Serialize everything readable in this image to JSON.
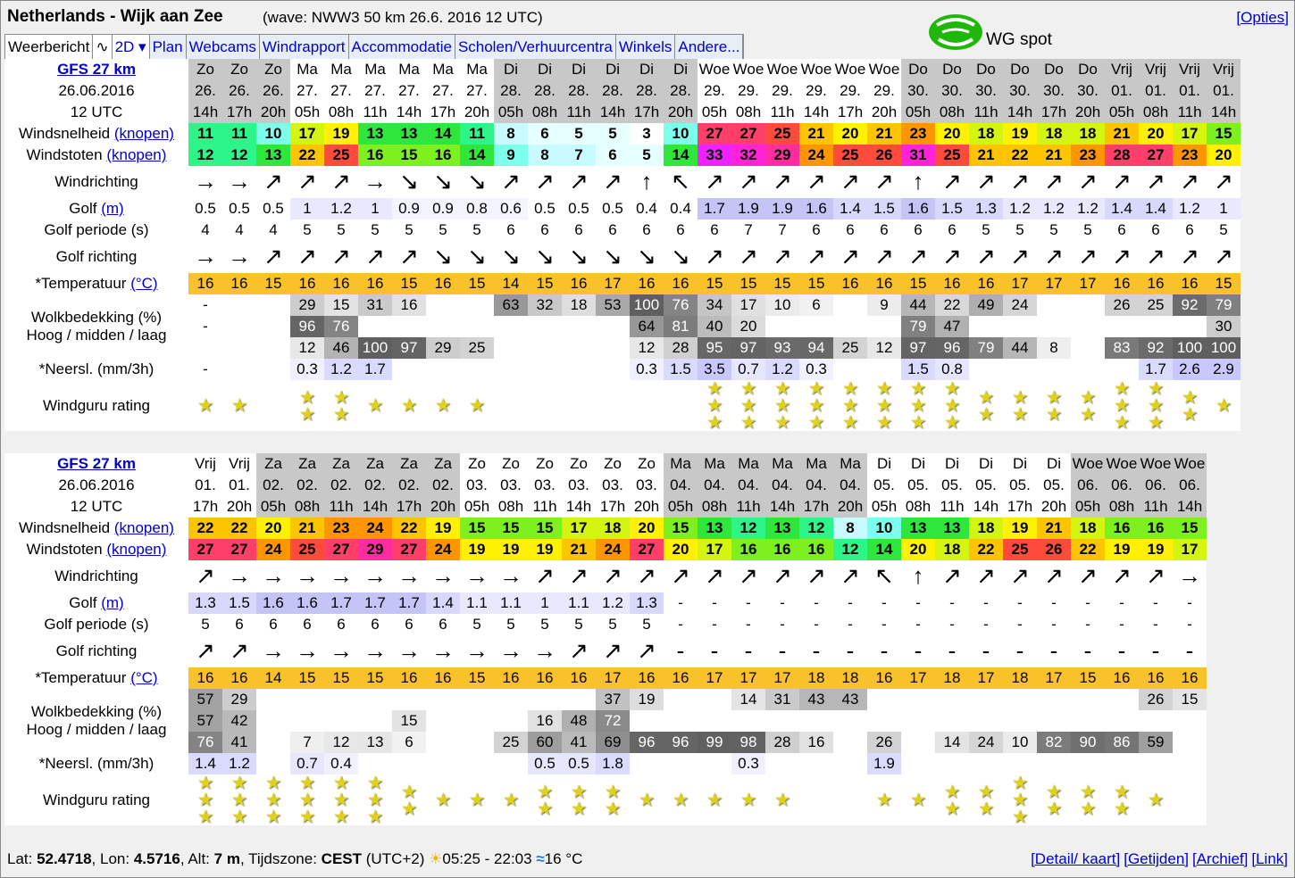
{
  "header": {
    "title": "Netherlands - Wijk aan Zee",
    "wave": "(wave: NWW3 50 km 26.6. 2016 12 UTC)",
    "opties": "[Opties]"
  },
  "tabs": [
    "Weerbericht",
    "∿",
    "2D ▾",
    "Plan",
    "Webcams",
    "Windrapport",
    "Accommodatie",
    "Scholen/Verhuurcentra",
    "Winkels",
    "Andere..."
  ],
  "logo": {
    "text": "WG spot",
    "color": "#1fb80a"
  },
  "labels": {
    "wind": "Windsnelheid",
    "gusts": "Windstoten",
    "knopen": "(knopen)",
    "dir": "Windrichting",
    "golf": "Golf",
    "m": "(m)",
    "periode": "Golf periode (s)",
    "golfrichting": "Golf richting",
    "temp": "*Temperatuur",
    "degc": "(°C)",
    "clouds1": "Wolkbedekking (%)",
    "clouds2": "Hoog / midden / laag",
    "rain": "*Neersl. (mm/3h)",
    "rating": "Windguru rating"
  },
  "colors": {
    "grey_day_bg": "#c8c8c8",
    "temp_bg": "#f9c22b",
    "link": "#0000cc"
  },
  "tables": [
    {
      "model": "GFS 27 km",
      "date": "26.06.2016",
      "utc": "12 UTC",
      "days": [
        "Zo",
        "Zo",
        "Zo",
        "Ma",
        "Ma",
        "Ma",
        "Ma",
        "Ma",
        "Ma",
        "Di",
        "Di",
        "Di",
        "Di",
        "Di",
        "Di",
        "Woe",
        "Woe",
        "Woe",
        "Woe",
        "Woe",
        "Woe",
        "Do",
        "Do",
        "Do",
        "Do",
        "Do",
        "Do",
        "Vrij",
        "Vrij",
        "Vrij",
        "Vrij"
      ],
      "dates": [
        "26.",
        "26.",
        "26.",
        "27.",
        "27.",
        "27.",
        "27.",
        "27.",
        "27.",
        "28.",
        "28.",
        "28.",
        "28.",
        "28.",
        "28.",
        "29.",
        "29.",
        "29.",
        "29.",
        "29.",
        "29.",
        "30.",
        "30.",
        "30.",
        "30.",
        "30.",
        "30.",
        "01.",
        "01.",
        "01.",
        "01."
      ],
      "hours": [
        "14h",
        "17h",
        "20h",
        "05h",
        "08h",
        "11h",
        "14h",
        "17h",
        "20h",
        "05h",
        "08h",
        "11h",
        "14h",
        "17h",
        "20h",
        "05h",
        "08h",
        "11h",
        "14h",
        "17h",
        "20h",
        "05h",
        "08h",
        "11h",
        "14h",
        "17h",
        "20h",
        "05h",
        "08h",
        "11h",
        "14h"
      ],
      "wind": [
        "11",
        "11",
        "10",
        "17",
        "19",
        "13",
        "13",
        "14",
        "11",
        "8",
        "6",
        "5",
        "5",
        "3",
        "10",
        "27",
        "27",
        "25",
        "21",
        "20",
        "21",
        "23",
        "20",
        "18",
        "19",
        "18",
        "18",
        "21",
        "20",
        "17",
        "15"
      ],
      "gust": [
        "12",
        "12",
        "13",
        "22",
        "25",
        "16",
        "15",
        "16",
        "14",
        "9",
        "8",
        "7",
        "6",
        "5",
        "14",
        "33",
        "32",
        "29",
        "24",
        "25",
        "26",
        "31",
        "25",
        "21",
        "22",
        "21",
        "23",
        "28",
        "27",
        "23",
        "20"
      ],
      "dir": [
        "→",
        "→",
        "↗",
        "↗",
        "↗",
        "→",
        "↘",
        "↘",
        "↘",
        "↗",
        "↗",
        "↗",
        "↗",
        "↑",
        "↖",
        "↗",
        "↗",
        "↗",
        "↗",
        "↗",
        "↗",
        "↑",
        "↗",
        "↗",
        "↗",
        "↗",
        "↗",
        "↗",
        "↗",
        "↗",
        "↗"
      ],
      "golf": [
        "0.5",
        "0.5",
        "0.5",
        "1",
        "1.2",
        "1",
        "0.9",
        "0.9",
        "0.8",
        "0.6",
        "0.5",
        "0.5",
        "0.5",
        "0.4",
        "0.4",
        "1.7",
        "1.9",
        "1.9",
        "1.6",
        "1.4",
        "1.5",
        "1.6",
        "1.5",
        "1.3",
        "1.2",
        "1.2",
        "1.2",
        "1.4",
        "1.4",
        "1.2",
        "1"
      ],
      "periode": [
        "4",
        "4",
        "4",
        "5",
        "5",
        "5",
        "5",
        "5",
        "5",
        "6",
        "6",
        "6",
        "6",
        "6",
        "6",
        "6",
        "7",
        "7",
        "6",
        "6",
        "6",
        "6",
        "6",
        "5",
        "5",
        "5",
        "5",
        "6",
        "6",
        "6",
        "5"
      ],
      "golfdir": [
        "→",
        "→",
        "↗",
        "↗",
        "↗",
        "↗",
        "↗",
        "↘",
        "↘",
        "↘",
        "↘",
        "↘",
        "↘",
        "↘",
        "↘",
        "↗",
        "↗",
        "↗",
        "↗",
        "↗",
        "↗",
        "↗",
        "↗",
        "↗",
        "↗",
        "↗",
        "↗",
        "↗",
        "↗",
        "↗",
        "↗"
      ],
      "temp": [
        "16",
        "16",
        "15",
        "16",
        "16",
        "16",
        "15",
        "16",
        "15",
        "14",
        "15",
        "16",
        "17",
        "16",
        "16",
        "15",
        "15",
        "15",
        "15",
        "16",
        "16",
        "15",
        "16",
        "16",
        "17",
        "17",
        "17",
        "16",
        "16",
        "16",
        "15"
      ],
      "cloud_hi": [
        "-",
        "",
        "",
        "29",
        "15",
        "31",
        "16",
        "",
        "",
        "63",
        "32",
        "18",
        "53",
        "100",
        "76",
        "34",
        "17",
        "10",
        "6",
        "",
        "9",
        "44",
        "22",
        "49",
        "24",
        "",
        "",
        "26",
        "25",
        "92",
        "79"
      ],
      "cloud_mid": [
        "-",
        "",
        "",
        "96",
        "76",
        "",
        "",
        "",
        "",
        "",
        "",
        "",
        "",
        "64",
        "81",
        "40",
        "20",
        "",
        "",
        "",
        "",
        "79",
        "47",
        "",
        "",
        "",
        "",
        "",
        "",
        "",
        "30"
      ],
      "cloud_lo": [
        "",
        "",
        "",
        "12",
        "46",
        "100",
        "97",
        "29",
        "25",
        "",
        "",
        "",
        "",
        "12",
        "28",
        "95",
        "97",
        "93",
        "94",
        "25",
        "12",
        "97",
        "96",
        "79",
        "44",
        "8",
        "",
        "83",
        "92",
        "100",
        "100"
      ],
      "rain": [
        "-",
        "",
        "",
        "0.3",
        "1.2",
        "1.7",
        "",
        "",
        "",
        "",
        "",
        "",
        "",
        "0.3",
        "1.5",
        "3.5",
        "0.7",
        "1.2",
        "0.3",
        "",
        "",
        "1.5",
        "0.8",
        "",
        "",
        "",
        "",
        "",
        "1.7",
        "2.6",
        "2.9"
      ],
      "stars": [
        1,
        1,
        0,
        2,
        2,
        1,
        1,
        1,
        1,
        0,
        0,
        0,
        0,
        0,
        0,
        3,
        3,
        3,
        3,
        3,
        3,
        3,
        3,
        2,
        2,
        2,
        2,
        3,
        3,
        2,
        1
      ]
    },
    {
      "model": "GFS 27 km",
      "date": "26.06.2016",
      "utc": "12 UTC",
      "days": [
        "Vrij",
        "Vrij",
        "Za",
        "Za",
        "Za",
        "Za",
        "Za",
        "Za",
        "Zo",
        "Zo",
        "Zo",
        "Zo",
        "Zo",
        "Zo",
        "Ma",
        "Ma",
        "Ma",
        "Ma",
        "Ma",
        "Ma",
        "Di",
        "Di",
        "Di",
        "Di",
        "Di",
        "Di",
        "Woe",
        "Woe",
        "Woe",
        "Woe"
      ],
      "dates": [
        "01.",
        "01.",
        "02.",
        "02.",
        "02.",
        "02.",
        "02.",
        "02.",
        "03.",
        "03.",
        "03.",
        "03.",
        "03.",
        "03.",
        "04.",
        "04.",
        "04.",
        "04.",
        "04.",
        "04.",
        "05.",
        "05.",
        "05.",
        "05.",
        "05.",
        "05.",
        "06.",
        "06.",
        "06.",
        "06."
      ],
      "hours": [
        "17h",
        "20h",
        "05h",
        "08h",
        "11h",
        "14h",
        "17h",
        "20h",
        "05h",
        "08h",
        "11h",
        "14h",
        "17h",
        "20h",
        "05h",
        "08h",
        "11h",
        "14h",
        "17h",
        "20h",
        "05h",
        "08h",
        "11h",
        "14h",
        "17h",
        "20h",
        "05h",
        "08h",
        "11h",
        "14h"
      ],
      "wind": [
        "22",
        "22",
        "20",
        "21",
        "23",
        "24",
        "22",
        "19",
        "15",
        "15",
        "15",
        "17",
        "18",
        "20",
        "15",
        "13",
        "12",
        "13",
        "12",
        "8",
        "10",
        "13",
        "13",
        "18",
        "19",
        "21",
        "18",
        "16",
        "16",
        "15"
      ],
      "gust": [
        "27",
        "27",
        "24",
        "25",
        "27",
        "29",
        "27",
        "24",
        "19",
        "19",
        "19",
        "21",
        "24",
        "27",
        "20",
        "17",
        "16",
        "16",
        "16",
        "12",
        "14",
        "20",
        "18",
        "22",
        "25",
        "26",
        "22",
        "19",
        "19",
        "17"
      ],
      "dir": [
        "↗",
        "→",
        "→",
        "→",
        "→",
        "→",
        "→",
        "→",
        "→",
        "→",
        "↗",
        "↗",
        "↗",
        "↗",
        "↗",
        "↗",
        "↗",
        "↗",
        "↗",
        "↗",
        "↖",
        "↑",
        "↗",
        "↗",
        "↗",
        "↗",
        "↗",
        "↗",
        "↗",
        "→"
      ],
      "golf": [
        "1.3",
        "1.5",
        "1.6",
        "1.6",
        "1.7",
        "1.7",
        "1.7",
        "1.4",
        "1.1",
        "1.1",
        "1",
        "1.1",
        "1.2",
        "1.3",
        "-",
        "-",
        "-",
        "-",
        "-",
        "-",
        "-",
        "-",
        "-",
        "-",
        "-",
        "-",
        "-",
        "-",
        "-",
        "-"
      ],
      "periode": [
        "5",
        "6",
        "6",
        "6",
        "6",
        "6",
        "6",
        "6",
        "5",
        "5",
        "5",
        "5",
        "5",
        "5",
        "-",
        "-",
        "-",
        "-",
        "-",
        "-",
        "-",
        "-",
        "-",
        "-",
        "-",
        "-",
        "-",
        "-",
        "-",
        "-"
      ],
      "golfdir": [
        "↗",
        "↗",
        "→",
        "→",
        "→",
        "→",
        "→",
        "→",
        "→",
        "→",
        "→",
        "↗",
        "↗",
        "↗",
        "-",
        "-",
        "-",
        "-",
        "-",
        "-",
        "-",
        "-",
        "-",
        "-",
        "-",
        "-",
        "-",
        "-",
        "-",
        "-"
      ],
      "temp": [
        "16",
        "16",
        "14",
        "15",
        "15",
        "15",
        "16",
        "16",
        "15",
        "16",
        "16",
        "16",
        "17",
        "16",
        "16",
        "17",
        "17",
        "17",
        "18",
        "18",
        "16",
        "17",
        "18",
        "17",
        "18",
        "17",
        "15",
        "16",
        "16",
        "16"
      ],
      "cloud_hi": [
        "57",
        "29",
        "",
        "",
        "",
        "",
        "",
        "",
        "",
        "",
        "",
        "",
        "37",
        "19",
        "",
        "",
        "14",
        "31",
        "43",
        "43",
        "",
        "",
        "",
        "",
        "",
        "",
        "",
        "",
        "26",
        "15"
      ],
      "cloud_mid": [
        "57",
        "42",
        "",
        "",
        "",
        "",
        "15",
        "",
        "",
        "",
        "16",
        "48",
        "72",
        "",
        "",
        "",
        "",
        "",
        "",
        "",
        "",
        "",
        "",
        "",
        "",
        "",
        "",
        "",
        "",
        ""
      ],
      "cloud_lo": [
        "76",
        "41",
        "",
        "7",
        "12",
        "13",
        "6",
        "",
        "",
        "25",
        "60",
        "41",
        "69",
        "96",
        "96",
        "99",
        "98",
        "28",
        "16",
        "",
        "26",
        "",
        "14",
        "24",
        "10",
        "82",
        "90",
        "86",
        "59",
        ""
      ],
      "rain": [
        "1.4",
        "1.2",
        "",
        "0.7",
        "0.4",
        "",
        "",
        "",
        "",
        "",
        "0.5",
        "0.5",
        "1.8",
        "",
        "",
        "",
        "0.3",
        "",
        "",
        "",
        "1.9",
        "",
        "",
        "",
        "",
        "",
        "",
        "",
        "",
        ""
      ],
      "stars": [
        3,
        3,
        3,
        3,
        3,
        3,
        2,
        1,
        1,
        1,
        2,
        2,
        2,
        1,
        1,
        1,
        1,
        1,
        0,
        0,
        1,
        1,
        2,
        2,
        3,
        2,
        2,
        2,
        1,
        0
      ]
    }
  ],
  "footer": {
    "lat_label": "Lat:",
    "lat": "52.4718",
    "lon_label": ", Lon:",
    "lon": "4.5716",
    "alt_label": ", Alt:",
    "alt": "7 m",
    "tz_label": ", Tijdszone:",
    "tz": "CEST",
    "tz_offset": "(UTC+2)",
    "sun": "05:25 - 22:03",
    "sea_temp": "16 °C"
  },
  "footer_links": [
    "[Detail/ kaart]",
    "[Getijden]",
    "[Archief]",
    "[Link]"
  ]
}
